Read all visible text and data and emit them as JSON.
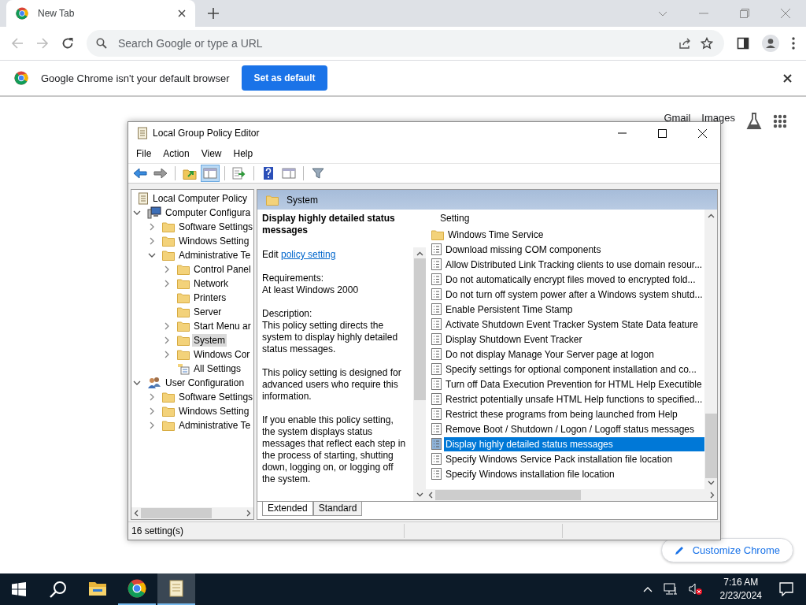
{
  "browser": {
    "tab": {
      "title": "New Tab"
    },
    "address": {
      "placeholder": "Search Google or type a URL"
    },
    "infobar": {
      "message": "Google Chrome isn't your default browser",
      "button": "Set as default"
    },
    "page_links": [
      "Gmail",
      "Images"
    ],
    "customize": "Customize Chrome"
  },
  "window": {
    "title": "Local Group Policy Editor",
    "menu": [
      "File",
      "Action",
      "View",
      "Help"
    ],
    "toolbar": [
      [
        {
          "kind": "back",
          "pressed": false
        },
        {
          "kind": "forward",
          "pressed": false
        }
      ],
      [
        {
          "kind": "up",
          "pressed": false
        },
        {
          "kind": "tree",
          "pressed": true
        }
      ],
      [
        {
          "kind": "export",
          "pressed": false
        }
      ],
      [
        {
          "kind": "help",
          "pressed": false
        },
        {
          "kind": "view",
          "pressed": false
        }
      ],
      [
        {
          "kind": "filter",
          "pressed": false
        }
      ]
    ],
    "tree": [
      {
        "label": "Local Computer Policy",
        "kind": "policy",
        "selected": false,
        "children": [
          {
            "label": "Computer Configura",
            "kind": "computer",
            "expandable": true,
            "expanded": true,
            "selected": false,
            "children": [
              {
                "label": "Software Settings",
                "kind": "folder",
                "expandable": true,
                "expanded": false,
                "selected": false
              },
              {
                "label": "Windows Setting",
                "kind": "folder",
                "expandable": true,
                "expanded": false,
                "selected": false
              },
              {
                "label": "Administrative Te",
                "kind": "folder",
                "expandable": true,
                "expanded": true,
                "selected": false,
                "children": [
                  {
                    "label": "Control Panel",
                    "kind": "folder",
                    "expandable": true,
                    "expanded": false,
                    "selected": false
                  },
                  {
                    "label": "Network",
                    "kind": "folder",
                    "expandable": true,
                    "expanded": false,
                    "selected": false
                  },
                  {
                    "label": "Printers",
                    "kind": "folder",
                    "expandable": false,
                    "expanded": false,
                    "selected": false
                  },
                  {
                    "label": "Server",
                    "kind": "folder",
                    "expandable": false,
                    "expanded": false,
                    "selected": false
                  },
                  {
                    "label": "Start Menu ar",
                    "kind": "folder",
                    "expandable": true,
                    "expanded": false,
                    "selected": false
                  },
                  {
                    "label": "System",
                    "kind": "folder",
                    "expandable": true,
                    "expanded": false,
                    "selected": true
                  },
                  {
                    "label": "Windows Cor",
                    "kind": "folder",
                    "expandable": true,
                    "expanded": false,
                    "selected": false
                  },
                  {
                    "label": "All Settings",
                    "kind": "settings",
                    "expandable": false,
                    "expanded": false,
                    "selected": false
                  }
                ]
              }
            ]
          },
          {
            "label": "User Configuration",
            "kind": "user",
            "expandable": true,
            "expanded": true,
            "selected": false,
            "children": [
              {
                "label": "Software Settings",
                "kind": "folder",
                "expandable": true,
                "expanded": false,
                "selected": false
              },
              {
                "label": "Windows Setting",
                "kind": "folder",
                "expandable": true,
                "expanded": false,
                "selected": false
              },
              {
                "label": "Administrative Te",
                "kind": "folder",
                "expandable": true,
                "expanded": false,
                "selected": false
              }
            ]
          }
        ]
      }
    ],
    "header": "System",
    "description": {
      "title": "Display highly detailed status messages",
      "edit_prefix": "Edit",
      "edit_link": "policy setting",
      "paragraphs": [
        "Requirements:\nAt least Windows 2000",
        "Description:\nThis policy setting directs the system to display highly detailed status messages.",
        "This policy setting is designed for advanced users who require this information.",
        "If you enable this policy setting, the system displays status messages that reflect each step in the process of starting, shutting down, logging on, or logging off the system."
      ]
    },
    "list": {
      "column": "Setting",
      "items": [
        {
          "label": "Windows Time Service",
          "kind": "folder",
          "selected": false
        },
        {
          "label": "Download missing COM components",
          "kind": "policy",
          "selected": false
        },
        {
          "label": "Allow Distributed Link Tracking clients to use domain resour...",
          "kind": "policy",
          "selected": false
        },
        {
          "label": "Do not automatically encrypt files moved to encrypted fold...",
          "kind": "policy",
          "selected": false
        },
        {
          "label": "Do not turn off system power after a Windows system shutd...",
          "kind": "policy",
          "selected": false
        },
        {
          "label": "Enable Persistent Time Stamp",
          "kind": "policy",
          "selected": false
        },
        {
          "label": "Activate Shutdown Event Tracker System State Data feature",
          "kind": "policy",
          "selected": false
        },
        {
          "label": "Display Shutdown Event Tracker",
          "kind": "policy",
          "selected": false
        },
        {
          "label": "Do not display Manage Your Server page at logon",
          "kind": "policy",
          "selected": false
        },
        {
          "label": "Specify settings for optional component installation and co...",
          "kind": "policy",
          "selected": false
        },
        {
          "label": "Turn off Data Execution Prevention for HTML Help Executible",
          "kind": "policy",
          "selected": false
        },
        {
          "label": "Restrict potentially unsafe HTML Help functions to specified...",
          "kind": "policy",
          "selected": false
        },
        {
          "label": "Restrict these programs from being launched from Help",
          "kind": "policy",
          "selected": false
        },
        {
          "label": "Remove Boot / Shutdown / Logon / Logoff status messages",
          "kind": "policy",
          "selected": false
        },
        {
          "label": "Display highly detailed status messages",
          "kind": "policy",
          "selected": true
        },
        {
          "label": "Specify Windows Service Pack installation file location",
          "kind": "policy",
          "selected": false
        },
        {
          "label": "Specify Windows installation file location",
          "kind": "policy",
          "selected": false
        }
      ]
    },
    "tabs": [
      {
        "label": "Extended",
        "selected": true
      },
      {
        "label": "Standard",
        "selected": false
      }
    ],
    "status": "16 setting(s)"
  },
  "taskbar": {
    "apps": [
      {
        "kind": "explorer",
        "running": false,
        "active": false
      },
      {
        "kind": "chrome",
        "running": true,
        "active": false
      },
      {
        "kind": "notepad",
        "running": true,
        "active": true
      }
    ],
    "time": "7:16 AM",
    "date": "2/23/2024"
  }
}
